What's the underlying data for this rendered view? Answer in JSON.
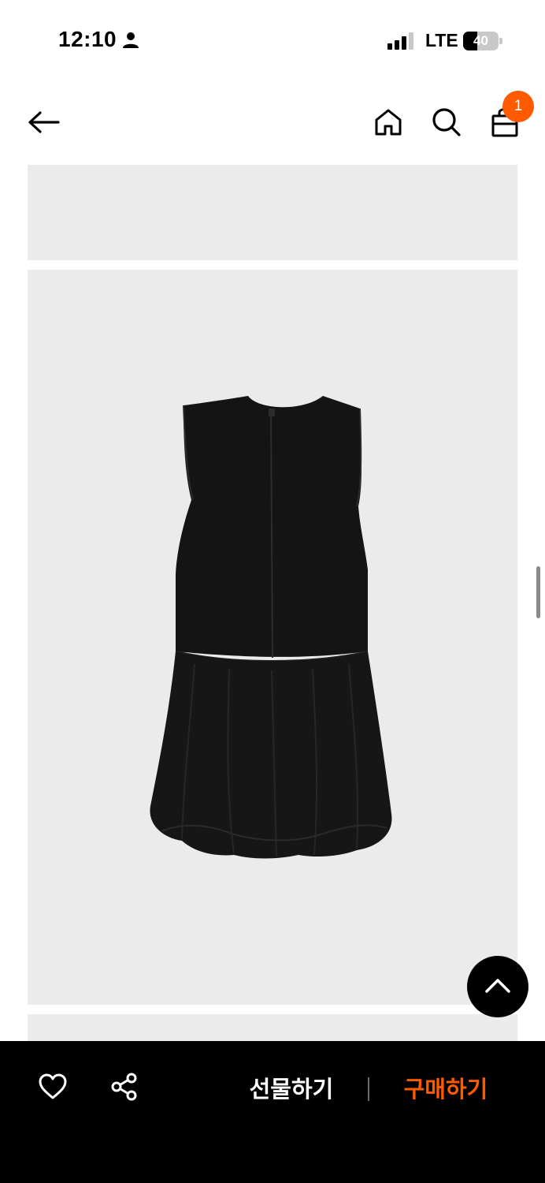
{
  "status_bar": {
    "time": "12:10",
    "network": "LTE",
    "battery_level": 40,
    "battery_label": "40",
    "person_icon": "person-icon",
    "signal_icon": "signal-bars-icon"
  },
  "nav": {
    "back_icon": "arrow-left-icon",
    "home_icon": "home-icon",
    "search_icon": "search-icon",
    "cart_icon": "shopping-bag-icon",
    "cart_badge": "1",
    "badge_color": "#ff5a00"
  },
  "content": {
    "panel_color": "#ebebeb",
    "product_image": "black-sleeveless-bubble-dress-back-view"
  },
  "floating": {
    "scroll_top_icon": "chevron-up-icon"
  },
  "bottom_bar": {
    "like_icon": "heart-icon",
    "share_icon": "share-icon",
    "gift_label": "선물하기",
    "buy_label": "구매하기",
    "accent_color": "#ff5a00",
    "background_color": "#000000"
  }
}
